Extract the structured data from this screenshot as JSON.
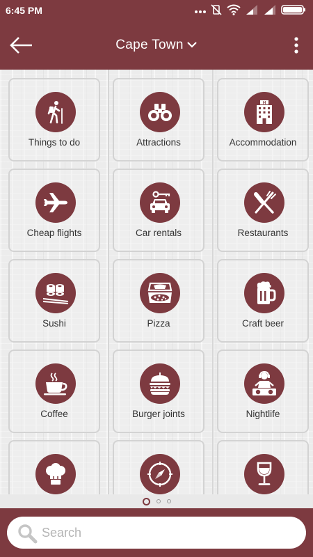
{
  "status_bar": {
    "time": "6:45 PM"
  },
  "header": {
    "city": "Cape Town",
    "back_icon": "arrow-left-icon",
    "menu_icon": "more-vertical-icon"
  },
  "categories": [
    {
      "label": "Things to do",
      "icon": "hiker-icon"
    },
    {
      "label": "Attractions",
      "icon": "binoculars-icon"
    },
    {
      "label": "Accommodation",
      "icon": "hotel-icon"
    },
    {
      "label": "Cheap flights",
      "icon": "airplane-icon"
    },
    {
      "label": "Car rentals",
      "icon": "car-key-icon"
    },
    {
      "label": "Restaurants",
      "icon": "fork-knife-icon"
    },
    {
      "label": "Sushi",
      "icon": "sushi-icon"
    },
    {
      "label": "Pizza",
      "icon": "pizza-box-icon"
    },
    {
      "label": "Craft beer",
      "icon": "beer-mug-icon"
    },
    {
      "label": "Coffee",
      "icon": "coffee-cup-icon"
    },
    {
      "label": "Burger joints",
      "icon": "burger-icon"
    },
    {
      "label": "Nightlife",
      "icon": "dj-icon"
    },
    {
      "label": "",
      "icon": "chef-hat-icon"
    },
    {
      "label": "",
      "icon": "compass-icon"
    },
    {
      "label": "",
      "icon": "wine-glass-icon"
    }
  ],
  "pager": {
    "pages": 3,
    "current": 1
  },
  "search": {
    "placeholder": "Search"
  },
  "colors": {
    "brand": "#7d3a40",
    "background": "#ececec"
  }
}
